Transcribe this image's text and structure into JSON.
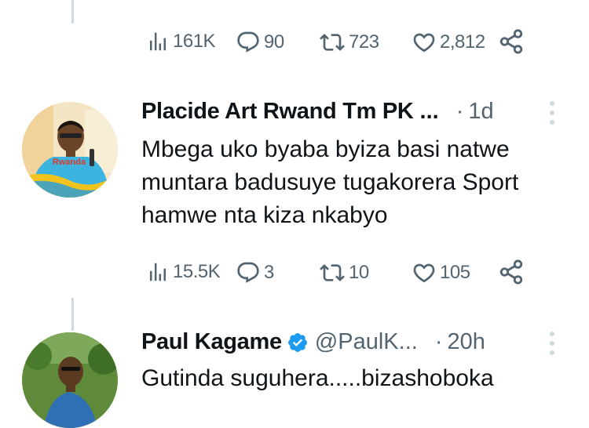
{
  "tweets": [
    {
      "metrics": {
        "views": "161K",
        "replies": "90",
        "retweets": "723",
        "likes": "2,812"
      }
    },
    {
      "author": {
        "name": "Placide Art Rwand Tm PK",
        "truncation": "...",
        "avatar_badge_text": "Rwanda"
      },
      "time": "1d",
      "text_lines": [
        "Mbega uko byaba byiza basi natwe",
        "muntara badusuye tugakorera Sport",
        "hamwe nta kiza nkabyo"
      ],
      "metrics": {
        "views": "15.5K",
        "replies": "3",
        "retweets": "10",
        "likes": "105"
      }
    },
    {
      "author": {
        "name": "Paul Kagame",
        "handle": "@PaulK...",
        "verified": true
      },
      "time": "20h",
      "text_lines": [
        "Gutinda suguhera.....bizashoboka"
      ]
    }
  ],
  "separator": "·",
  "colors": {
    "text": "#0f1419",
    "secondary": "#536471",
    "thread_line": "#cfd9de",
    "verified": "#1d9bf0"
  },
  "icons": [
    "views-icon",
    "reply-icon",
    "retweet-icon",
    "like-icon",
    "share-icon",
    "more-icon",
    "verified-badge-icon"
  ]
}
